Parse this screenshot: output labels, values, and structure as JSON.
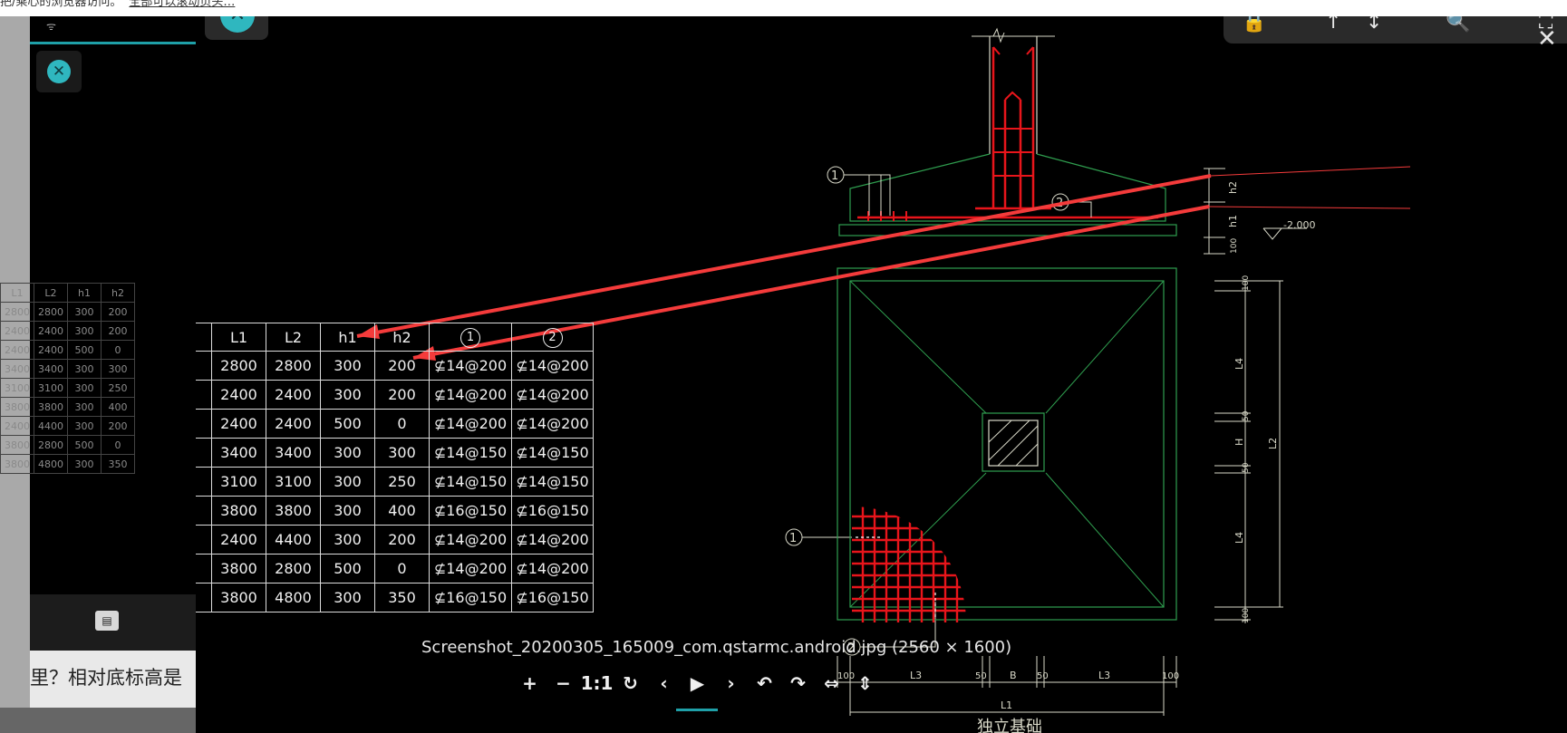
{
  "topbar": {
    "text": "把/乘心的浏览器访问。",
    "link": "全部可以滚动页头…"
  },
  "background": {
    "wifi": "ᯤ",
    "close_glyph": "✕",
    "chat_glyph": "▤",
    "bottom_text": "里？相对底标高是",
    "table": {
      "headers": [
        "L1",
        "L2",
        "h1",
        "h2"
      ],
      "rows": [
        [
          "2800",
          "2800",
          "300",
          "200"
        ],
        [
          "2400",
          "2400",
          "300",
          "200"
        ],
        [
          "2400",
          "2400",
          "500",
          "0"
        ],
        [
          "3400",
          "3400",
          "300",
          "300"
        ],
        [
          "3100",
          "3100",
          "300",
          "250"
        ],
        [
          "3800",
          "3800",
          "300",
          "400"
        ],
        [
          "2400",
          "4400",
          "300",
          "200"
        ],
        [
          "3800",
          "2800",
          "500",
          "0"
        ],
        [
          "3800",
          "4800",
          "300",
          "350"
        ]
      ]
    }
  },
  "viewer": {
    "close_glyph": "✕",
    "tools": [
      "🔒",
      "↑",
      "↕",
      "🔍",
      "⛶"
    ],
    "window_close": "✕",
    "caption": "Screenshot_20200305_165009_com.qstarmc.android.jpg (2560 × 1600)",
    "controls": [
      {
        "name": "zoom-in",
        "glyph": "+"
      },
      {
        "name": "zoom-out",
        "glyph": "−"
      },
      {
        "name": "actual-size",
        "glyph": "1:1"
      },
      {
        "name": "reset",
        "glyph": "↻"
      },
      {
        "name": "prev",
        "glyph": "‹"
      },
      {
        "name": "play",
        "glyph": "▶"
      },
      {
        "name": "next",
        "glyph": "›"
      },
      {
        "name": "rotate-left",
        "glyph": "↶"
      },
      {
        "name": "rotate-right",
        "glyph": "↷"
      },
      {
        "name": "flip-horizontal",
        "glyph": "⇔"
      },
      {
        "name": "flip-vertical",
        "glyph": "⇕"
      }
    ]
  },
  "drawing": {
    "labels": {
      "elev": "-2.000",
      "h2": "h2",
      "h1": "h1",
      "h100": "100",
      "l4a": "L4",
      "l4b": "L4",
      "h": "H",
      "l2": "L2",
      "d50a": "50",
      "d50b": "50",
      "d100a": "100",
      "d100b": "100",
      "b100l": "100",
      "l3a": "L3",
      "b50a": "50",
      "b": "B",
      "b50b": "50",
      "l3b": "L3",
      "b100r": "100",
      "l1": "L1",
      "title": "独立基础",
      "c1a": "1",
      "c2a": "2",
      "c1b": "1",
      "c2b": "2"
    }
  },
  "table": {
    "headers": [
      "L1",
      "L2",
      "h1",
      "h2",
      "1",
      "2"
    ],
    "rows": [
      {
        "L1": "2800",
        "L2": "2800",
        "h1": "300",
        "h2": "200",
        "r1": "⊈14@200",
        "r2": "⊈14@200"
      },
      {
        "L1": "2400",
        "L2": "2400",
        "h1": "300",
        "h2": "200",
        "r1": "⊈14@200",
        "r2": "⊈14@200"
      },
      {
        "L1": "2400",
        "L2": "2400",
        "h1": "500",
        "h2": "0",
        "r1": "⊈14@200",
        "r2": "⊈14@200"
      },
      {
        "L1": "3400",
        "L2": "3400",
        "h1": "300",
        "h2": "300",
        "r1": "⊈14@150",
        "r2": "⊈14@150"
      },
      {
        "L1": "3100",
        "L2": "3100",
        "h1": "300",
        "h2": "250",
        "r1": "⊈14@150",
        "r2": "⊈14@150"
      },
      {
        "L1": "3800",
        "L2": "3800",
        "h1": "300",
        "h2": "400",
        "r1": "⊈16@150",
        "r2": "⊈16@150"
      },
      {
        "L1": "2400",
        "L2": "4400",
        "h1": "300",
        "h2": "200",
        "r1": "⊈14@200",
        "r2": "⊈14@200"
      },
      {
        "L1": "3800",
        "L2": "2800",
        "h1": "500",
        "h2": "0",
        "r1": "⊈14@200",
        "r2": "⊈14@200"
      },
      {
        "L1": "3800",
        "L2": "4800",
        "h1": "300",
        "h2": "350",
        "r1": "⊈16@150",
        "r2": "⊈16@150"
      }
    ]
  },
  "colors": {
    "accent": "#2fb7bf",
    "rebar": "#e8151b",
    "outline": "#2f9e4f",
    "arrow": "#f43b3b"
  }
}
